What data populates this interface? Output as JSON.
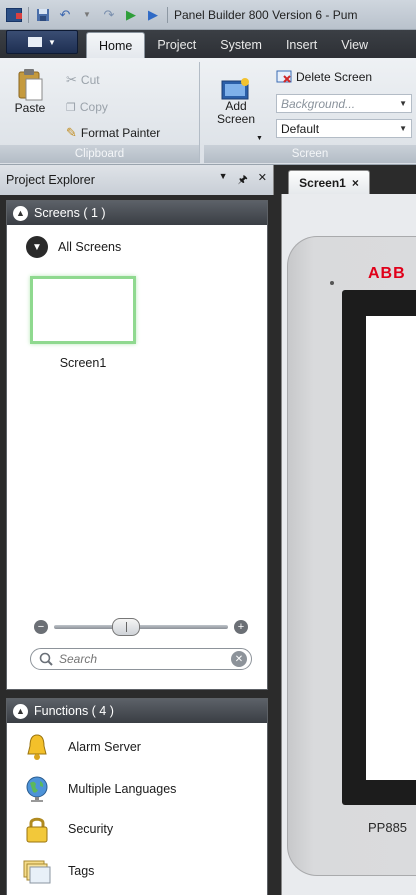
{
  "app": {
    "title": "Panel Builder 800 Version 6 - Pum"
  },
  "ribbon_tabs": [
    "Home",
    "Project",
    "System",
    "Insert",
    "View"
  ],
  "ribbon": {
    "clipboard": {
      "label": "Clipboard",
      "paste": "Paste",
      "cut": "Cut",
      "copy": "Copy",
      "format_painter": "Format Painter"
    },
    "screen": {
      "label": "Screen",
      "add_screen": "Add\nScreen",
      "delete_screen": "Delete Screen",
      "background_placeholder": "Background...",
      "template_value": "Default"
    }
  },
  "explorer": {
    "title": "Project Explorer",
    "pin_icon": "pin-icon",
    "screens_header": "Screens ( 1 )",
    "all_screens": "All Screens",
    "screen_thumb_label": "Screen1",
    "zoom_value": 0.4,
    "search_placeholder": "Search",
    "functions_header": "Functions ( 4 )",
    "functions": [
      {
        "label": "Alarm Server",
        "icon": "bell-icon"
      },
      {
        "label": "Multiple Languages",
        "icon": "globe-icon"
      },
      {
        "label": "Security",
        "icon": "lock-icon"
      },
      {
        "label": "Tags",
        "icon": "tags-icon"
      }
    ]
  },
  "editor": {
    "tab_label": "Screen1",
    "brand": "ABB",
    "model": "PP885"
  },
  "colors": {
    "selection_green": "#8fd98f",
    "brand_red": "#e0001a",
    "ribbon_dark": "#2d3035"
  }
}
